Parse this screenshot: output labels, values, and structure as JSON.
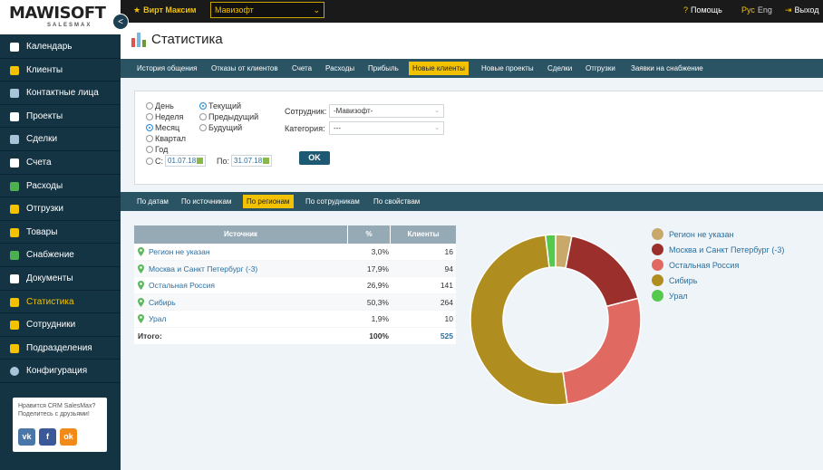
{
  "app": {
    "logo_main": "MAWISOFT",
    "logo_sub": "SALESMAX",
    "collapse_icon": "<"
  },
  "topbar": {
    "user": "Вирт Максим",
    "company": "Мавизофт",
    "help": "Помощь",
    "lang_active": "Рус",
    "lang_other": "Eng",
    "logout": "Выход",
    "accent": "#f2c200"
  },
  "sidebar": {
    "items": [
      {
        "label": "Календарь",
        "icon": "calendar-icon",
        "color": "#ffffff"
      },
      {
        "label": "Клиенты",
        "icon": "star-icon",
        "color": "#f2c200"
      },
      {
        "label": "Контактные лица",
        "icon": "contact-card-icon",
        "color": "#a7c4d8"
      },
      {
        "label": "Проекты",
        "icon": "projects-icon",
        "color": "#ffffff"
      },
      {
        "label": "Сделки",
        "icon": "deals-icon",
        "color": "#a7c4d8"
      },
      {
        "label": "Счета",
        "icon": "invoices-icon",
        "color": "#ffffff"
      },
      {
        "label": "Расходы",
        "icon": "expenses-icon",
        "color": "#4caf50"
      },
      {
        "label": "Отгрузки",
        "icon": "truck-icon",
        "color": "#f2c200"
      },
      {
        "label": "Товары",
        "icon": "goods-icon",
        "color": "#f2c200"
      },
      {
        "label": "Снабжение",
        "icon": "supply-icon",
        "color": "#4caf50"
      },
      {
        "label": "Документы",
        "icon": "documents-icon",
        "color": "#ffffff"
      },
      {
        "label": "Статистика",
        "icon": "statistics-icon",
        "color": "#f2c200"
      },
      {
        "label": "Сотрудники",
        "icon": "employees-icon",
        "color": "#f2c200"
      },
      {
        "label": "Подразделения",
        "icon": "departments-icon",
        "color": "#f2c200"
      },
      {
        "label": "Конфигурация",
        "icon": "gear-icon",
        "color": "#a7c4d8"
      }
    ],
    "active_index": 11,
    "share": {
      "text_line1": "Нравится CRM SalesMax?",
      "text_line2": "Поделитесь с друзьями!",
      "vk": "vk",
      "fb": "f",
      "ok": "ok"
    }
  },
  "page": {
    "title": "Статистика"
  },
  "tabs_main": [
    {
      "label": "История общения"
    },
    {
      "label": "Отказы от клиентов"
    },
    {
      "label": "Счета"
    },
    {
      "label": "Расходы"
    },
    {
      "label": "Прибыль"
    },
    {
      "label": "Новые клиенты"
    },
    {
      "label": "Новые проекты"
    },
    {
      "label": "Сделки"
    },
    {
      "label": "Отгрузки"
    },
    {
      "label": "Заявки на снабжение"
    }
  ],
  "tabs_main_active": 5,
  "filters": {
    "period_options": [
      "День",
      "Неделя",
      "Месяц",
      "Квартал",
      "Год"
    ],
    "period_selected": 2,
    "relative_options": [
      "Текущий",
      "Предыдущий",
      "Будущий"
    ],
    "relative_selected": 0,
    "from_label": "С:",
    "from_value": "01.07.18",
    "to_label": "По:",
    "to_value": "31.07.18",
    "employee_label": "Сотрудник:",
    "employee_value": "-Мавизофт-",
    "category_label": "Категория:",
    "category_value": "---",
    "ok_label": "OK"
  },
  "tabs_sub": [
    {
      "label": "По датам"
    },
    {
      "label": "По источникам"
    },
    {
      "label": "По регионам"
    },
    {
      "label": "По сотрудникам"
    },
    {
      "label": "По свойствам"
    }
  ],
  "tabs_sub_active": 2,
  "table": {
    "headers": [
      "Источник",
      "%",
      "Клиенты"
    ],
    "rows": [
      {
        "region": "Регион не указан",
        "pct": "3,0%",
        "count": "16"
      },
      {
        "region": "Москва и Санкт Петербург (-3)",
        "pct": "17,9%",
        "count": "94"
      },
      {
        "region": "Остальная Россия",
        "pct": "26,9%",
        "count": "141"
      },
      {
        "region": "Сибирь",
        "pct": "50,3%",
        "count": "264"
      },
      {
        "region": "Урал",
        "pct": "1,9%",
        "count": "10"
      }
    ],
    "total_label": "Итого:",
    "total_pct": "100%",
    "total_count": "525"
  },
  "chart_data": {
    "type": "pie",
    "categories": [
      "Регион не указан",
      "Москва и Санкт Петербург (-3)",
      "Остальная Россия",
      "Сибирь",
      "Урал"
    ],
    "values": [
      16,
      94,
      141,
      264,
      10
    ],
    "colors": [
      "#c8a96a",
      "#9b2f2c",
      "#e06a62",
      "#b08d1f",
      "#55c94e"
    ],
    "donut": true,
    "legend": "right"
  }
}
